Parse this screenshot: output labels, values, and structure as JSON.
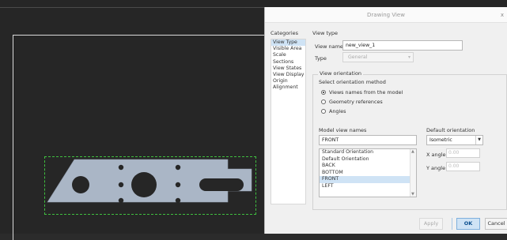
{
  "dialog": {
    "title": "Drawing View",
    "close_glyph": "x",
    "categories": {
      "heading": "Categories",
      "items": [
        {
          "label": "View Type",
          "selected": true
        },
        {
          "label": "Visible Area",
          "selected": false
        },
        {
          "label": "Scale",
          "selected": false
        },
        {
          "label": "Sections",
          "selected": false
        },
        {
          "label": "View States",
          "selected": false
        },
        {
          "label": "View Display",
          "selected": false
        },
        {
          "label": "Origin",
          "selected": false
        },
        {
          "label": "Alignment",
          "selected": false
        }
      ]
    },
    "view_type": {
      "heading": "View type",
      "view_name_label": "View name",
      "view_name_value": "new_view_1",
      "type_label": "Type",
      "type_value": "General"
    },
    "view_orientation": {
      "heading": "View orientation",
      "select_method_label": "Select orientation method",
      "methods": [
        {
          "label": "Views names from the model",
          "checked": true
        },
        {
          "label": "Geometry references",
          "checked": false
        },
        {
          "label": "Angles",
          "checked": false
        }
      ],
      "model_view_names_label": "Model view names",
      "model_view_names_value": "FRONT",
      "model_view_list": [
        "Standard Orientation",
        "Default Orientation",
        "BACK",
        "BOTTOM",
        "FRONT",
        "LEFT"
      ],
      "model_view_selected": "FRONT",
      "default_orientation_label": "Default orientation",
      "default_orientation_value": "Isometric",
      "x_angle_label": "X angle",
      "x_angle_value": "0.00",
      "y_angle_label": "Y angle",
      "y_angle_value": "0.00"
    },
    "buttons": {
      "apply": "Apply",
      "ok": "OK",
      "cancel": "Cancel"
    }
  },
  "colors": {
    "canvas_bg": "#262626",
    "part_fill": "#aab6c6",
    "selection_dash": "#3fbf3f",
    "highlight": "#cfe3f5"
  }
}
